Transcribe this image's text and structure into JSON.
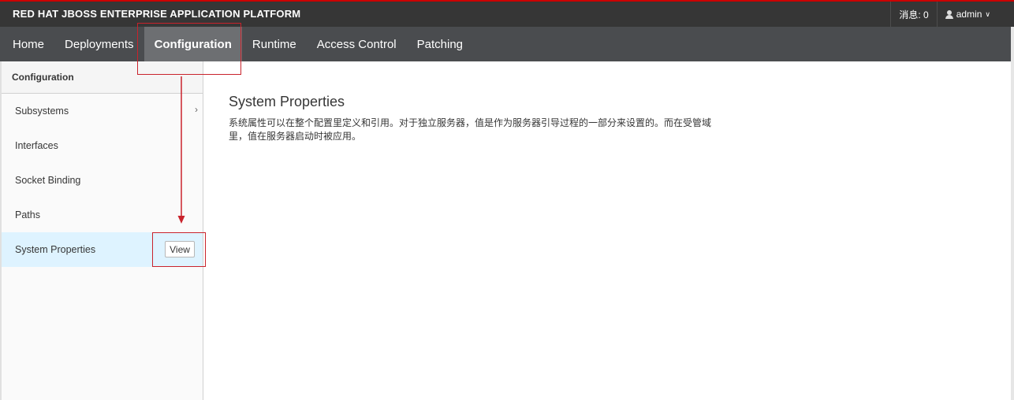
{
  "brand": {
    "title": "RED HAT JBOSS ENTERPRISE APPLICATION PLATFORM"
  },
  "topbar": {
    "messages": "消息: 0",
    "user": "admin"
  },
  "nav": {
    "items": [
      "Home",
      "Deployments",
      "Configuration",
      "Runtime",
      "Access Control",
      "Patching"
    ],
    "active": "Configuration"
  },
  "sidebar": {
    "header": "Configuration",
    "items": [
      {
        "label": "Subsystems"
      },
      {
        "label": "Interfaces"
      },
      {
        "label": "Socket Binding"
      },
      {
        "label": "Paths"
      },
      {
        "label": "System Properties",
        "button": "View"
      }
    ]
  },
  "main": {
    "title": "System Properties",
    "description": "系统属性可以在整个配置里定义和引用。对于独立服务器，值是作为服务器引导过程的一部分来设置的。而在受管域里，值在服务器启动时被应用。"
  },
  "annotation": {
    "color": "#c9232c"
  }
}
